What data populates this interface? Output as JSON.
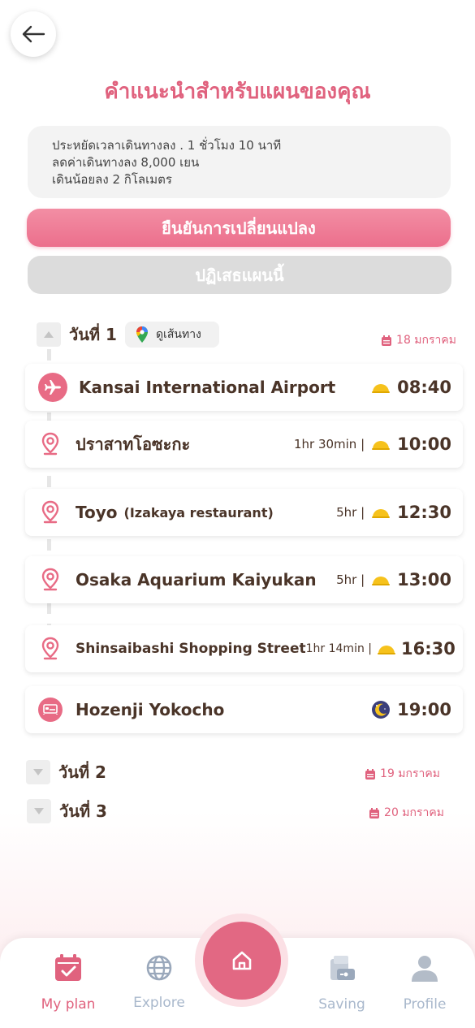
{
  "header": {
    "title": "คำแนะนำสำหรับแผนของคุณ"
  },
  "summary": {
    "line1": "ประหยัดเวลาเดินทางลง .  1 ชั่วโมง 10 นาที",
    "line2": "ลดค่าเดินทางลง    8,000 เยน",
    "line3": "เดินน้อยลง    2 กิโลเมตร"
  },
  "actions": {
    "confirm_label": "ยืนยันการเปลี่ยนแปลง",
    "reject_label": "ปฏิเสธแผนนี้"
  },
  "days": [
    {
      "label": "วันที่ 1",
      "date": "18 มกราคม",
      "route_label": "ดูเส้นทาง",
      "stops": [
        {
          "name": "Kansai International Airport",
          "sub": "",
          "duration": "",
          "time": "08:40",
          "icon": "airplane-icon",
          "time_icon": "sun-icon"
        },
        {
          "name": "ปราสาทโอซะกะ",
          "sub": "",
          "duration": "1hr 30min |",
          "time": "10:00",
          "icon": "location-pin-icon",
          "time_icon": "sun-icon"
        },
        {
          "name": "Toyo",
          "sub": "(Izakaya restaurant)",
          "duration": "5hr |",
          "time": "12:30",
          "icon": "location-pin-icon",
          "time_icon": "sun-icon"
        },
        {
          "name": "Osaka Aquarium Kaiyukan",
          "sub": "",
          "duration": "5hr |",
          "time": "13:00",
          "icon": "location-pin-icon",
          "time_icon": "sun-icon"
        },
        {
          "name": "Shinsaibashi Shopping Street",
          "sub": "",
          "duration": "1hr 14min |",
          "time": "16:30",
          "icon": "location-pin-icon",
          "time_icon": "sun-icon"
        },
        {
          "name": "Hozenji Yokocho",
          "sub": "",
          "duration": "",
          "time": "19:00",
          "icon": "bed-icon",
          "time_icon": "moon-icon"
        }
      ]
    },
    {
      "label": "วันที่ 2",
      "date": "19 มกราคม"
    },
    {
      "label": "วันที่ 3",
      "date": "20 มกราคม"
    }
  ],
  "nav": {
    "my_plan": "My plan",
    "explore": "Explore",
    "saving": "Saving",
    "profile": "Profile"
  },
  "colors": {
    "accent": "#e0627e",
    "text_dark": "#4a3428",
    "inactive": "#a9b8cc"
  }
}
